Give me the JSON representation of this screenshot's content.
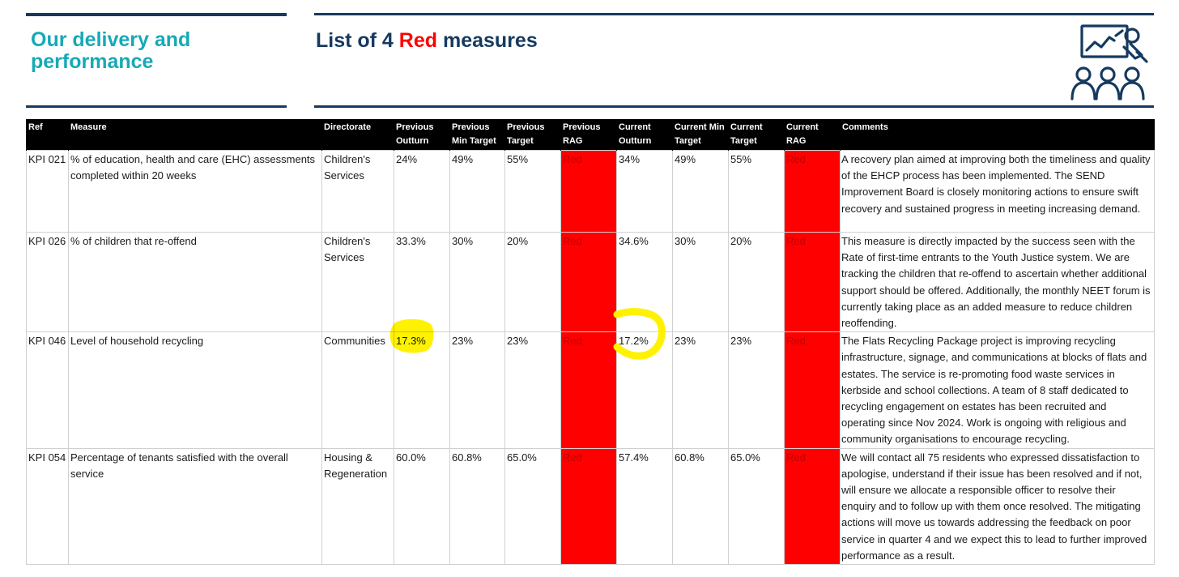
{
  "header": {
    "section_title": "Our delivery and performance",
    "title_prefix": "List of 4 ",
    "title_highlight": "Red",
    "title_suffix": " measures",
    "icon": "presentation-audience-icon"
  },
  "colors": {
    "accent_teal": "#17a9b7",
    "navy": "#163a5f",
    "rag_red": "#ff0000",
    "highlight_yellow": "#fff200"
  },
  "table": {
    "headers": [
      "Ref",
      "Measure",
      "Directorate",
      "Previous Outturn",
      "Previous Min Target",
      "Previous Target",
      "Previous RAG",
      "Current Outturn",
      "Current Min Target",
      "Current Target",
      "Current RAG",
      "Comments"
    ],
    "rows": [
      {
        "ref": "KPI 021",
        "measure": "% of education, health and care (EHC) assessments completed within 20 weeks",
        "directorate": "Children's Services",
        "prev_outturn": "24%",
        "prev_min_target": "49%",
        "prev_target": "55%",
        "prev_rag": "Red",
        "curr_outturn": "34%",
        "curr_min_target": "49%",
        "curr_target": "55%",
        "curr_rag": "Red",
        "comments": "A recovery plan aimed at improving both the timeliness and quality of the EHCP process has been implemented. The SEND Improvement Board is closely monitoring actions to ensure swift recovery and sustained progress in meeting increasing demand."
      },
      {
        "ref": "KPI 026",
        "measure": "% of children that re-offend",
        "directorate": "Children's Services",
        "prev_outturn": "33.3%",
        "prev_min_target": "30%",
        "prev_target": "20%",
        "prev_rag": "Red",
        "curr_outturn": "34.6%",
        "curr_min_target": "30%",
        "curr_target": "20%",
        "curr_rag": "Red",
        "comments": "This measure is directly impacted by the success seen with the Rate of first-time entrants to the Youth Justice system. We are tracking the children that re-offend to ascertain whether additional support should be offered.  Additionally, the monthly NEET forum is currently taking place as an added measure to reduce children reoffending."
      },
      {
        "ref": "KPI 046",
        "measure": "Level of household recycling",
        "directorate": "Communities",
        "prev_outturn": "17.3%",
        "prev_min_target": "23%",
        "prev_target": "23%",
        "prev_rag": "Red",
        "curr_outturn": "17.2%",
        "curr_min_target": "23%",
        "curr_target": "23%",
        "curr_rag": "Red",
        "comments": "The Flats Recycling Package project is improving recycling infrastructure, signage, and communications at blocks of flats and estates. The service is re-promoting food waste services in kerbside and school collections. A team of 8 staff dedicated to recycling engagement on estates has been recruited and operating since Nov 2024. Work is ongoing with religious and community organisations to encourage recycling."
      },
      {
        "ref": "KPI 054",
        "measure": "Percentage of tenants satisfied with the overall service",
        "directorate": "Housing & Regeneration",
        "prev_outturn": "60.0%",
        "prev_min_target": "60.8%",
        "prev_target": "65.0%",
        "prev_rag": "Red",
        "curr_outturn": "57.4%",
        "curr_min_target": "60.8%",
        "curr_target": "65.0%",
        "curr_rag": "Red",
        "comments": "We will contact all 75 residents who expressed dissatisfaction to apologise, understand if their issue has been resolved and if not, will ensure we allocate a responsible officer to resolve their enquiry and to follow up with them once resolved. The mitigating actions will move us towards addressing the feedback on poor service in quarter 4 and we expect this to lead to further improved performance as a result."
      }
    ]
  }
}
